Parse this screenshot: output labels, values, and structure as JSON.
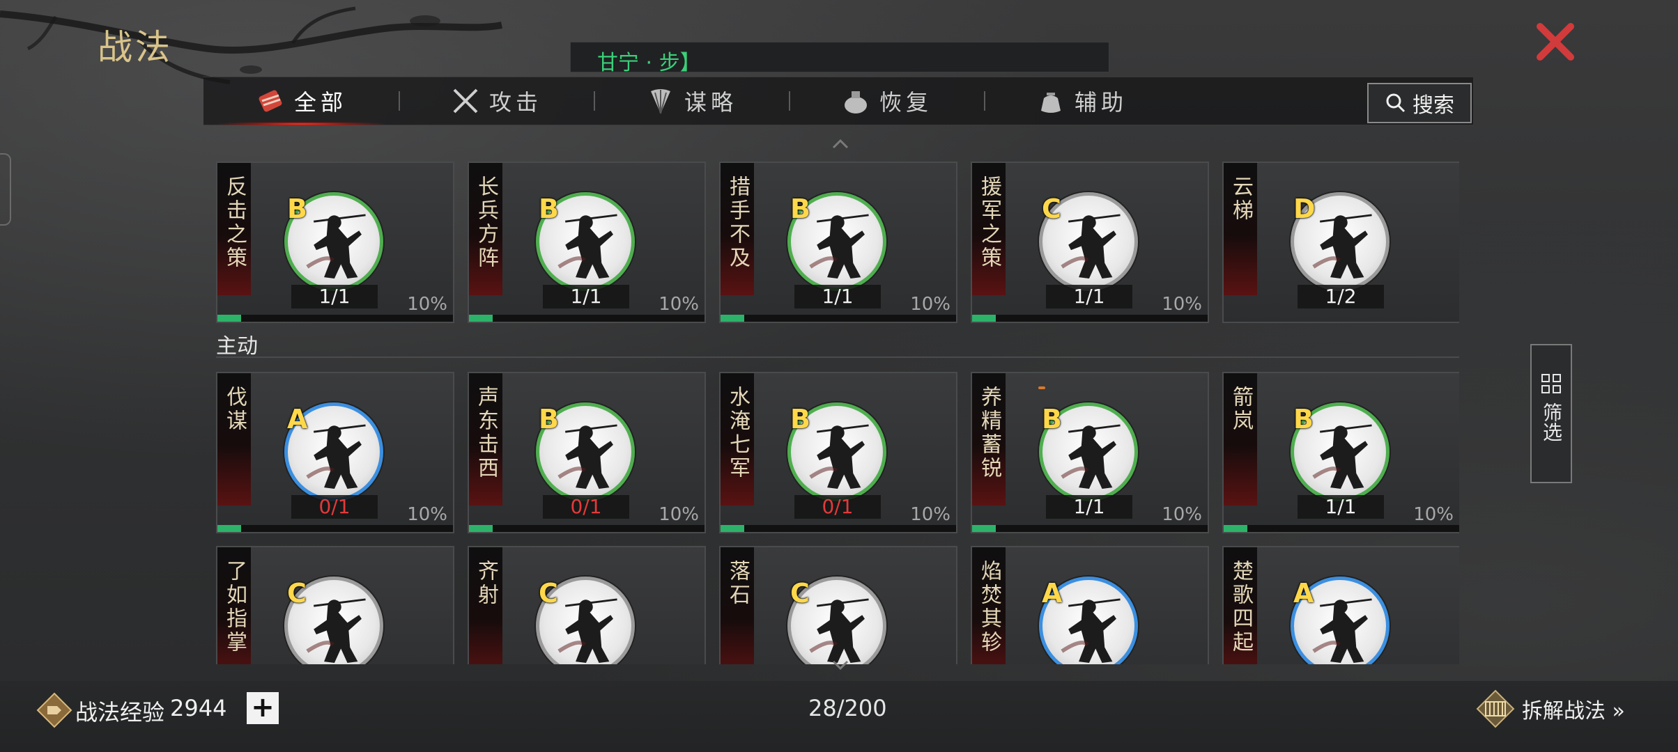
{
  "title": "战法",
  "hero_filter": "甘宁 · 步】",
  "tabs": [
    {
      "label": "全部",
      "active": true
    },
    {
      "label": "攻击",
      "active": false
    },
    {
      "label": "谋略",
      "active": false
    },
    {
      "label": "恢复",
      "active": false
    },
    {
      "label": "辅助",
      "active": false
    }
  ],
  "search_label": "搜索",
  "section_active_label": "主动",
  "filter_label": "筛选",
  "cards_row1": [
    {
      "name": "反击之策",
      "grade": "B",
      "ring": "green",
      "count": "1/1",
      "pct": "10%",
      "progress": 0.1
    },
    {
      "name": "长兵方阵",
      "grade": "B",
      "ring": "green",
      "count": "1/1",
      "pct": "10%",
      "progress": 0.1
    },
    {
      "name": "措手不及",
      "grade": "B",
      "ring": "green",
      "count": "1/1",
      "pct": "10%",
      "progress": 0.1
    },
    {
      "name": "援军之策",
      "grade": "C",
      "ring": "gray",
      "count": "1/1",
      "pct": "10%",
      "progress": 0.1
    },
    {
      "name": "云梯",
      "grade": "D",
      "ring": "gray",
      "count": "1/2",
      "pct": "",
      "progress": 0
    }
  ],
  "cards_row2": [
    {
      "name": "伐谋",
      "grade": "A",
      "ring": "blue",
      "count": "0/1",
      "pct": "10%",
      "progress": 0.1
    },
    {
      "name": "声东击西",
      "grade": "B",
      "ring": "green",
      "count": "0/1",
      "pct": "10%",
      "progress": 0.1
    },
    {
      "name": "水淹七军",
      "grade": "B",
      "ring": "green",
      "count": "0/1",
      "pct": "10%",
      "progress": 0.1
    },
    {
      "name": "养精蓄锐",
      "grade": "B",
      "ring": "green",
      "count": "1/1",
      "pct": "10%",
      "progress": 0.1
    },
    {
      "name": "箭岚",
      "grade": "B",
      "ring": "green",
      "count": "1/1",
      "pct": "10%",
      "progress": 0.1
    }
  ],
  "cards_row3": [
    {
      "name": "了如指掌",
      "grade": "C",
      "ring": "gray"
    },
    {
      "name": "齐射",
      "grade": "C",
      "ring": "gray"
    },
    {
      "name": "落石",
      "grade": "C",
      "ring": "gray"
    },
    {
      "name": "焰焚其轸",
      "grade": "A",
      "ring": "blue"
    },
    {
      "name": "楚歌四起",
      "grade": "A",
      "ring": "blue"
    }
  ],
  "bottom": {
    "exp_label": "战法经验",
    "exp_value": "2944",
    "plus_label": "+",
    "total": "28/200",
    "dismantle_label": "拆解战法 »"
  },
  "colors": {
    "ring_green": "#4fae4f",
    "ring_blue": "#3b8fe0",
    "ring_gray": "#9a9a9a",
    "grade": "#ffd84a",
    "zero_count": "#e23a3a",
    "progress": "#2db26a",
    "hero_text": "#3ad07a",
    "title": "#d9c48a",
    "close": "#d23b3b"
  }
}
